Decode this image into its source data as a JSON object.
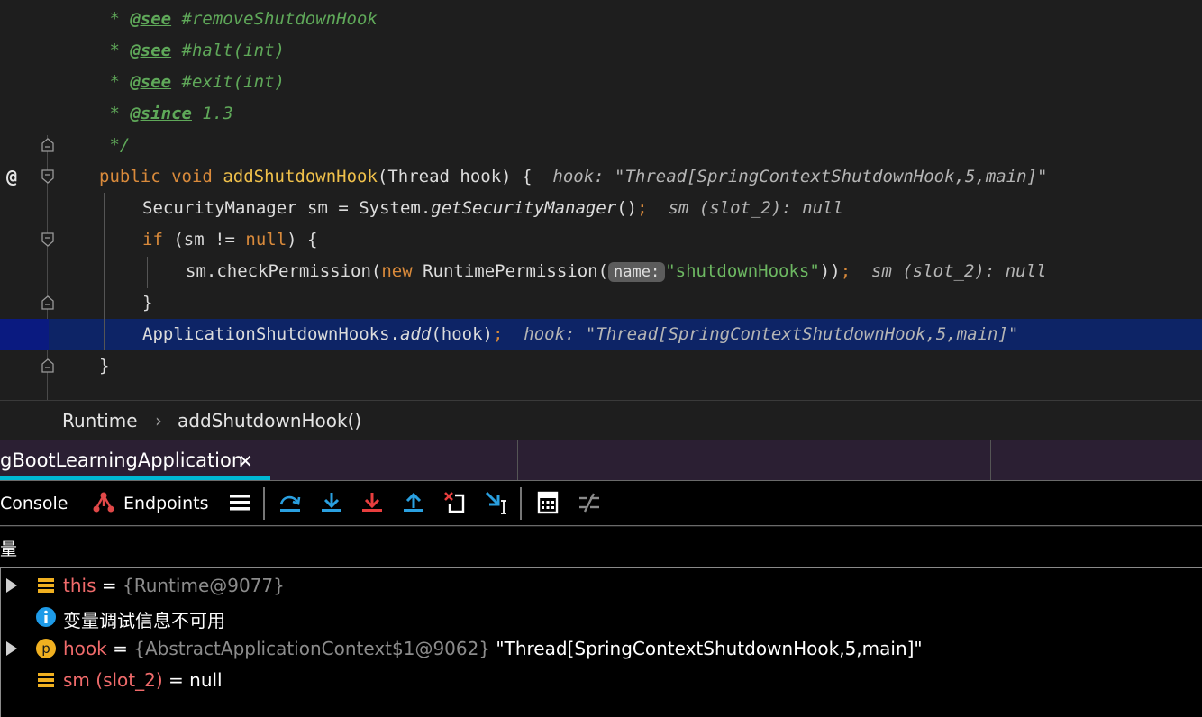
{
  "editor": {
    "doc_lines": [
      {
        "tag": "@see",
        "text": " #removeShutdownHook"
      },
      {
        "tag": "@see",
        "text": " #halt(int)"
      },
      {
        "tag": "@see",
        "text": " #exit(int)"
      },
      {
        "tag": "@since",
        "text": " 1.3"
      }
    ],
    "doc_star": " * ",
    "doc_end": " */",
    "annotation_marker": "@",
    "method_decl": {
      "kw_public": "public",
      "kw_void": "void",
      "name": "addShutdownHook",
      "params": "(Thread hook) {",
      "inline_value": "hook: \"Thread[SpringContextShutdownHook,5,main]\""
    },
    "line_sm": {
      "prefix": "SecurityManager sm = System.",
      "call": "getSecurityManager",
      "suffix": "()",
      "semi": ";",
      "inline_value": "sm (slot_2): null"
    },
    "line_if": {
      "kw_if": "if",
      "cond_a": " (sm != ",
      "kw_null": "null",
      "cond_b": ") {"
    },
    "line_check": {
      "prefix": "sm.checkPermission(",
      "kw_new": "new",
      "type": " RuntimePermission(",
      "param_hint": "name:",
      "string": "\"shutdownHooks\"",
      "close": "))",
      "semi": ";",
      "inline_value": "sm (slot_2): null"
    },
    "line_close_if": "}",
    "line_add": {
      "prefix": "ApplicationShutdownHooks.",
      "call": "add",
      "suffix": "(hook)",
      "semi": ";",
      "inline_value": "hook: \"Thread[SpringContextShutdownHook,5,main]\""
    },
    "line_close_method": "}"
  },
  "breadcrumb": {
    "class_name": "Runtime",
    "separator": "›",
    "method_name": "addShutdownHook()"
  },
  "debug_tabs": {
    "session_label": "gBootLearningApplication",
    "close_symbol": "✕"
  },
  "toolbar": {
    "console_label": "Console",
    "endpoints_label": "Endpoints",
    "icons": [
      "frames-menu-icon",
      "step-over-icon",
      "step-into-icon",
      "force-step-into-icon",
      "step-out-icon",
      "drop-frame-icon",
      "run-to-cursor-icon",
      "evaluate-expression-icon",
      "trace-icon"
    ]
  },
  "variables": {
    "header": "量",
    "rows": [
      {
        "name": "this",
        "eq": " = ",
        "type": "{Runtime@9077}",
        "value": "",
        "icon": "field-icon",
        "expandable": true
      },
      {
        "name": "",
        "eq": "",
        "type": "",
        "value": "变量调试信息不可用",
        "icon": "info-icon",
        "expandable": false
      },
      {
        "name": "hook",
        "eq": " = ",
        "type": "{AbstractApplicationContext$1@9062}",
        "value": " \"Thread[SpringContextShutdownHook,5,main]\"",
        "icon": "parameter-icon",
        "expandable": true
      },
      {
        "name": "sm (slot_2)",
        "eq": " = ",
        "type": "",
        "value": "null",
        "icon": "field-icon",
        "expandable": false
      }
    ]
  },
  "colors": {
    "editor_bg": "#1e1e1e",
    "current_line": "#0d2466",
    "keyword": "#d98a3b",
    "method_name": "#f0c14b",
    "comment": "#5fa859",
    "string": "#6db862",
    "var_name": "#f06b6b",
    "tab_accent": "#00b8d4"
  }
}
